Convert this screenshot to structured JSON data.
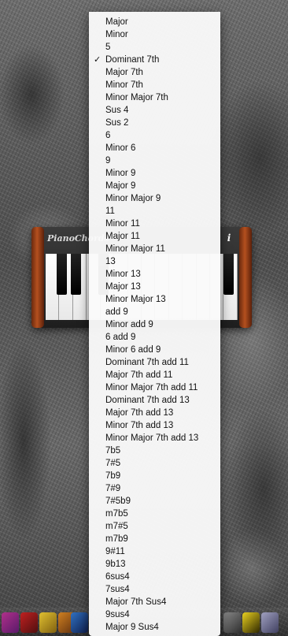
{
  "widget": {
    "title": "PianoChords",
    "info_label": "i"
  },
  "menu": {
    "selected_index": 3,
    "check_glyph": "✓",
    "items": [
      "Major",
      "Minor",
      "5",
      "Dominant 7th",
      "Major 7th",
      "Minor 7th",
      "Minor Major 7th",
      "Sus 4",
      "Sus 2",
      "6",
      "Minor 6",
      "9",
      "Minor 9",
      "Major 9",
      "Minor Major 9",
      "11",
      "Minor 11",
      "Major 11",
      "Minor Major 11",
      "13",
      "Minor 13",
      "Major 13",
      "Minor Major 13",
      "add 9",
      "Minor add 9",
      "6 add 9",
      "Minor 6 add 9",
      "Dominant 7th add 11",
      "Major 7th add 11",
      "Minor Major 7th add 11",
      "Dominant 7th add 13",
      "Major 7th add 13",
      "Minor 7th add 13",
      "Minor Major 7th add 13",
      "7b5",
      "7#5",
      "7b9",
      "7#9",
      "7#5b9",
      "m7b5",
      "m7#5",
      "m7b9",
      "9#11",
      "9b13",
      "6sus4",
      "7sus4",
      "Major 7th Sus4",
      "9sus4",
      "Major 9 Sus4"
    ]
  },
  "colors": {
    "widget_wood": "#b4501f",
    "menu_bg": "#fafafa"
  }
}
